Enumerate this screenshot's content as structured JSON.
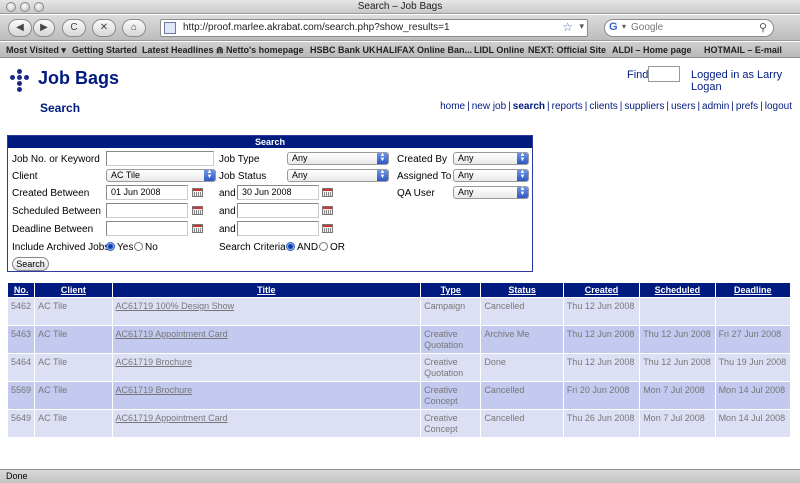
{
  "window": {
    "title": "Search – Job Bags"
  },
  "browser": {
    "back_label": "◀",
    "forward_label": "▶",
    "reload_label": "C",
    "stop_label": "✕",
    "home_label": "⌂",
    "url": "http://proof.marlee.akrabat.com/search.php?show_results=1",
    "search_placeholder": "Google",
    "search_engine_label": "G"
  },
  "bookmarks": [
    "Most Visited ▾",
    "Getting Started",
    "Latest Headlines ⋒",
    "Netto's homepage",
    "HSBC Bank UK",
    "HALIFAX Online Ban...",
    "LIDL Online",
    "NEXT: Official Site",
    "ALDI – Home page",
    "HOTMAIL – E-mail"
  ],
  "header": {
    "app_title": "Job Bags",
    "page_subtitle": "Search",
    "find_label": "Find",
    "logged_in": "Logged in as Larry Logan"
  },
  "nav": [
    {
      "label": "home",
      "active": false
    },
    {
      "label": "new job",
      "active": false
    },
    {
      "label": "search",
      "active": true
    },
    {
      "label": "reports",
      "active": false
    },
    {
      "label": "clients",
      "active": false
    },
    {
      "label": "suppliers",
      "active": false
    },
    {
      "label": "users",
      "active": false
    },
    {
      "label": "admin",
      "active": false
    },
    {
      "label": "prefs",
      "active": false
    },
    {
      "label": "logout",
      "active": false
    }
  ],
  "search": {
    "heading": "Search",
    "job_no_label": "Job No. or Keyword",
    "job_no_value": "",
    "client_label": "Client",
    "client_value": "AC Tile",
    "created_between_label": "Created Between",
    "created_from": "01 Jun 2008",
    "created_to": "30 Jun 2008",
    "scheduled_between_label": "Scheduled Between",
    "deadline_between_label": "Deadline Between",
    "and_label": "and",
    "include_archived_label": "Include Archived Jobs",
    "yes_label": "Yes",
    "no_label": "No",
    "job_type_label": "Job Type",
    "job_type_value": "Any",
    "job_status_label": "Job Status",
    "job_status_value": "Any",
    "search_criteria_label": "Search Criteria",
    "and_option_label": "AND",
    "or_option_label": "OR",
    "created_by_label": "Created By",
    "created_by_value": "Any",
    "assigned_to_label": "Assigned To",
    "assigned_to_value": "Any",
    "qa_user_label": "QA User",
    "qa_user_value": "Any",
    "search_button": "Search"
  },
  "results": {
    "columns": [
      "No.",
      "Client",
      "Title",
      "Type",
      "Status",
      "Created",
      "Scheduled",
      "Deadline"
    ],
    "rows": [
      {
        "no": "5462",
        "client": "AC Tile",
        "title": "AC61719 100% Design Show",
        "type": "Campaign",
        "status": "Cancelled",
        "created": "Thu 12 Jun 2008",
        "scheduled": "",
        "deadline": ""
      },
      {
        "no": "5463",
        "client": "AC Tile",
        "title": "AC61719 Appointment Card",
        "type": "Creative Quotation",
        "status": "Archive Me",
        "created": "Thu 12 Jun 2008",
        "scheduled": "Thu 12 Jun 2008",
        "deadline": "Fri 27 Jun 2008"
      },
      {
        "no": "5464",
        "client": "AC Tile",
        "title": "AC61719 Brochure",
        "type": "Creative Quotation",
        "status": "Done",
        "created": "Thu 12 Jun 2008",
        "scheduled": "Thu 12 Jun 2008",
        "deadline": "Thu 19 Jun 2008"
      },
      {
        "no": "5569",
        "client": "AC Tile",
        "title": "AC61719 Brochure",
        "type": "Creative Concept",
        "status": "Cancelled",
        "created": "Fri 20 Jun 2008",
        "scheduled": "Mon 7 Jul 2008",
        "deadline": "Mon 14 Jul 2008"
      },
      {
        "no": "5649",
        "client": "AC Tile",
        "title": "AC61719 Appointment Card",
        "type": "Creative Concept",
        "status": "Cancelled",
        "created": "Thu 26 Jun 2008",
        "scheduled": "Mon 7 Jul 2008",
        "deadline": "Mon 14 Jul 2008"
      }
    ]
  },
  "status_bar": "Done"
}
